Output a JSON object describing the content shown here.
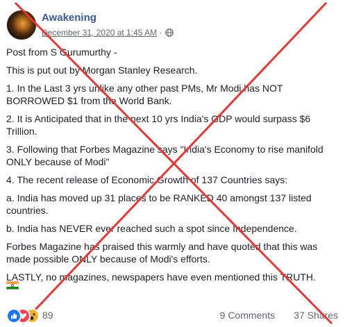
{
  "post": {
    "author": "Awakening",
    "date": "December 31, 2020 at 1:45 AM",
    "separator": "·",
    "paragraphs": [
      "Post from S Gurumurthy -",
      "This is put out by Morgan Stanley Research.",
      "1. In the Last 3 yrs unlike any other past PMs, Mr Modi has NOT BORROWED $1 from the World Bank.",
      "2. It is Anticipated that in the next 10 yrs India's GDP would surpass $6 Trillion.",
      "3. Following that Forbes Magazine says \"India's Economy to rise manifold ONLY because of Modi\"",
      "4. The recent release of Economic Growth of 137 Countries says:",
      "a. India has moved up 31 places to be RANKED 40 amongst 137 listed countries.",
      "b. India has NEVER ever reached such a spot since Independence.",
      "Forbes Magazine has praised this warmly and have quoted that this was made possible ONLY because of Modi's efforts.",
      "LASTLY, no magazines, newspapers have even mentioned this TRUTH."
    ],
    "icons": {
      "privacy": "globe-icon",
      "flag": "india-flag-icon"
    }
  },
  "footer": {
    "reaction_count": "89",
    "comments": "9 Comments",
    "shares": "37 Shares",
    "reaction_icons": [
      "like-icon",
      "love-icon",
      "wow-icon"
    ]
  },
  "overlay": {
    "type": "fact-check-cross",
    "color": "#e53935"
  }
}
